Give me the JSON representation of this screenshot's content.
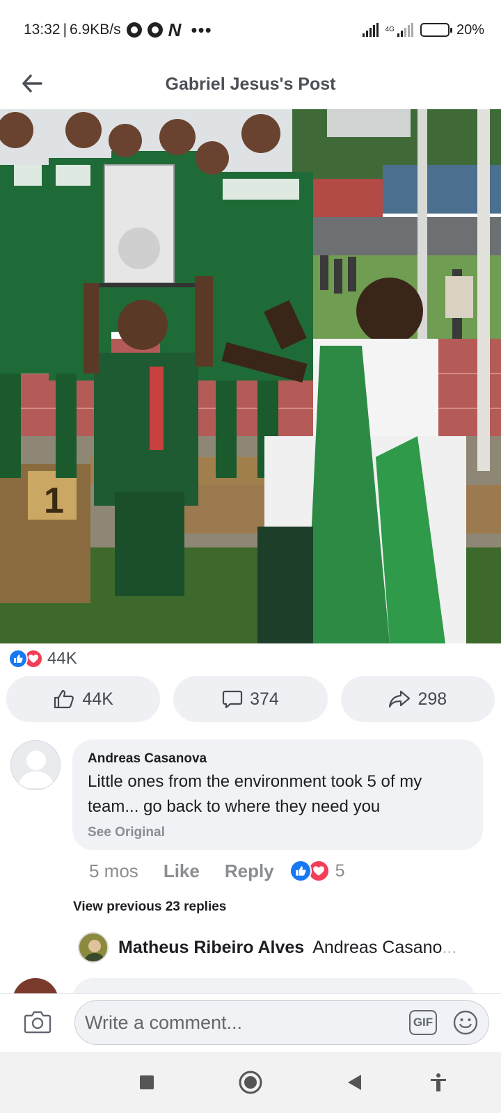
{
  "status_bar": {
    "time": "13:32",
    "net_speed": "6.9KB/s",
    "network_type": "4G",
    "battery": "20%",
    "battery_level": 0.2,
    "icons": [
      "chrome-icon",
      "chrome-icon",
      "netflix-icon",
      "more-dots-icon",
      "signal-icon",
      "signal-4g-icon",
      "battery-icon"
    ]
  },
  "header": {
    "title": "Gabriel Jesus's Post",
    "back_icon": "arrow-left-icon"
  },
  "post": {
    "photo_icon": "team-photo"
  },
  "reactions": {
    "total": "44K",
    "types": [
      "like",
      "love"
    ]
  },
  "actions": [
    {
      "icon": "thumbs-up-icon",
      "label": "44K"
    },
    {
      "icon": "comment-bubble-icon",
      "label": "374"
    },
    {
      "icon": "share-arrow-icon",
      "label": "298"
    }
  ],
  "comment": {
    "author": "Andreas Casanova",
    "text": "Little ones from the environment took 5 of my team... go back to where they need you",
    "see_original": "See Original",
    "age": "5 mos",
    "like_label": "Like",
    "reply_label": "Reply",
    "reaction_count": "5"
  },
  "view_previous": "View previous 23 replies",
  "reply": {
    "author": "Matheus Ribeiro Alves",
    "text_preview": "Andreas Casano"
  },
  "composer": {
    "placeholder": "Write a comment...",
    "gif_label": "GIF"
  },
  "colors": {
    "like_blue": "#1877f2",
    "love_red": "#f33e58",
    "bubble_bg": "#f0f2f5",
    "muted_text": "#8a8d91"
  }
}
